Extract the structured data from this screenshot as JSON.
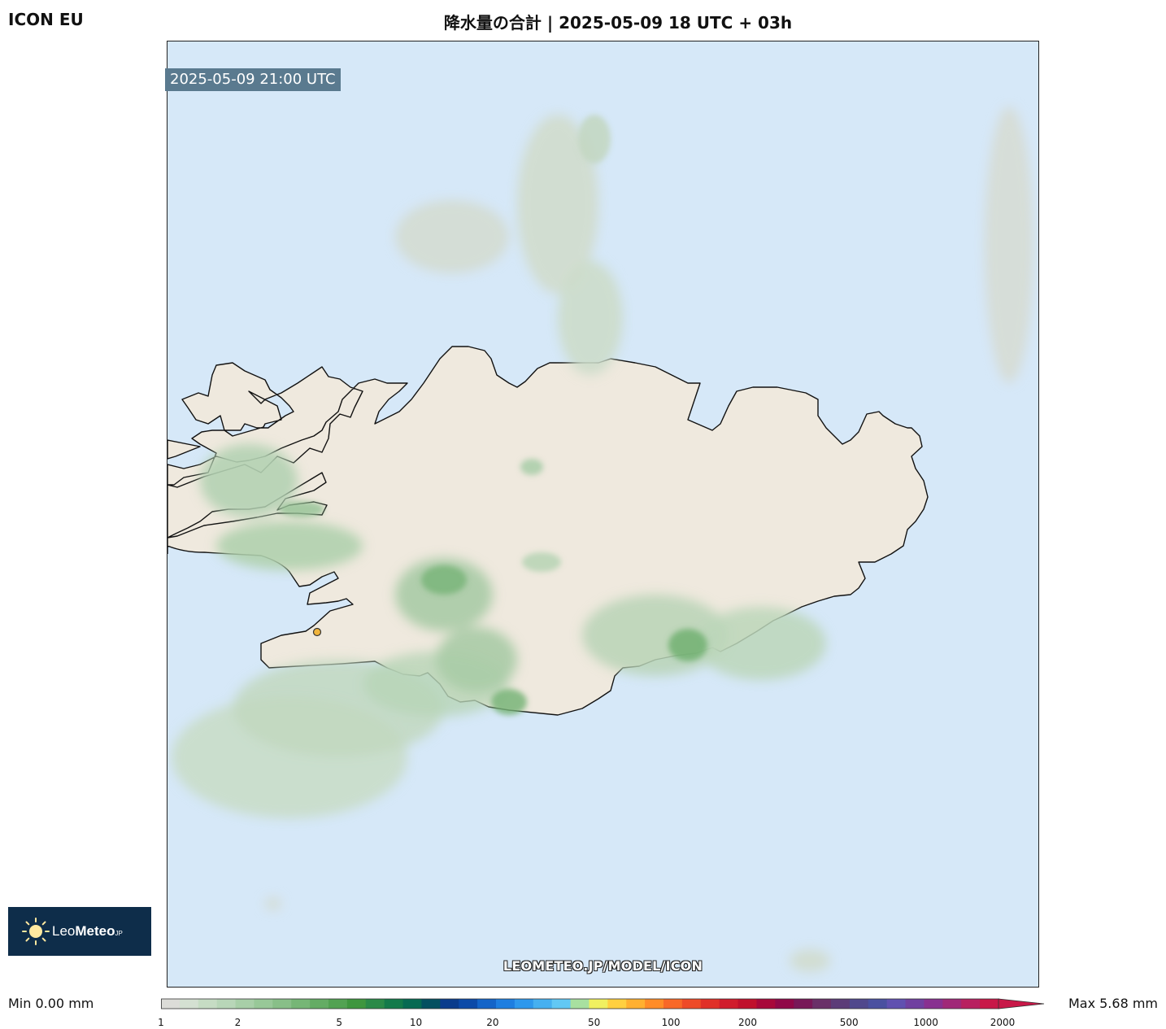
{
  "header": {
    "model": "ICON EU",
    "title": "降水量の合計 | 2025-05-09 18 UTC + 03h"
  },
  "map": {
    "valid_time": "2025-05-09 21:00 UTC",
    "watermark": "LEOMETEO.JP/MODEL/ICON",
    "colors": {
      "sea": "#d6e8f8",
      "land": "#efe9de",
      "coast": "#111111",
      "marker": "#f0b43c"
    },
    "marker_icon": "location-dot-icon"
  },
  "logo": {
    "icon": "sun-icon",
    "text_leo": "Leo",
    "text_meteo": "Meteo",
    "text_suffix": "JP"
  },
  "legend": {
    "min": "Min 0.00 mm",
    "max": "Max 5.68 mm",
    "ticks": [
      "1",
      "2",
      "5",
      "10",
      "20",
      "50",
      "100",
      "200",
      "500",
      "1000",
      "2000"
    ],
    "colors": [
      "#dcdcd8",
      "#d4e0d2",
      "#c6dcc4",
      "#b8d6b8",
      "#a8cfa8",
      "#98c898",
      "#88bf88",
      "#76b676",
      "#64ac64",
      "#52a252",
      "#3e963e",
      "#2a8a48",
      "#137a4a",
      "#066a52",
      "#045060",
      "#0a3c8c",
      "#0c4aa8",
      "#1464c8",
      "#1e7ee0",
      "#2e98ec",
      "#46b0f0",
      "#62c8f4",
      "#a8e0a0",
      "#f0f060",
      "#ffd040",
      "#ffb030",
      "#ff8c28",
      "#f86828",
      "#ee4a28",
      "#e03028",
      "#d01c2c",
      "#c0102c",
      "#a8083a",
      "#900848",
      "#781858",
      "#6a3068",
      "#5c3c78",
      "#50488c",
      "#4a50a0",
      "#6050b0",
      "#7040a0",
      "#883090",
      "#a02878",
      "#b82060",
      "#c81848"
    ]
  }
}
